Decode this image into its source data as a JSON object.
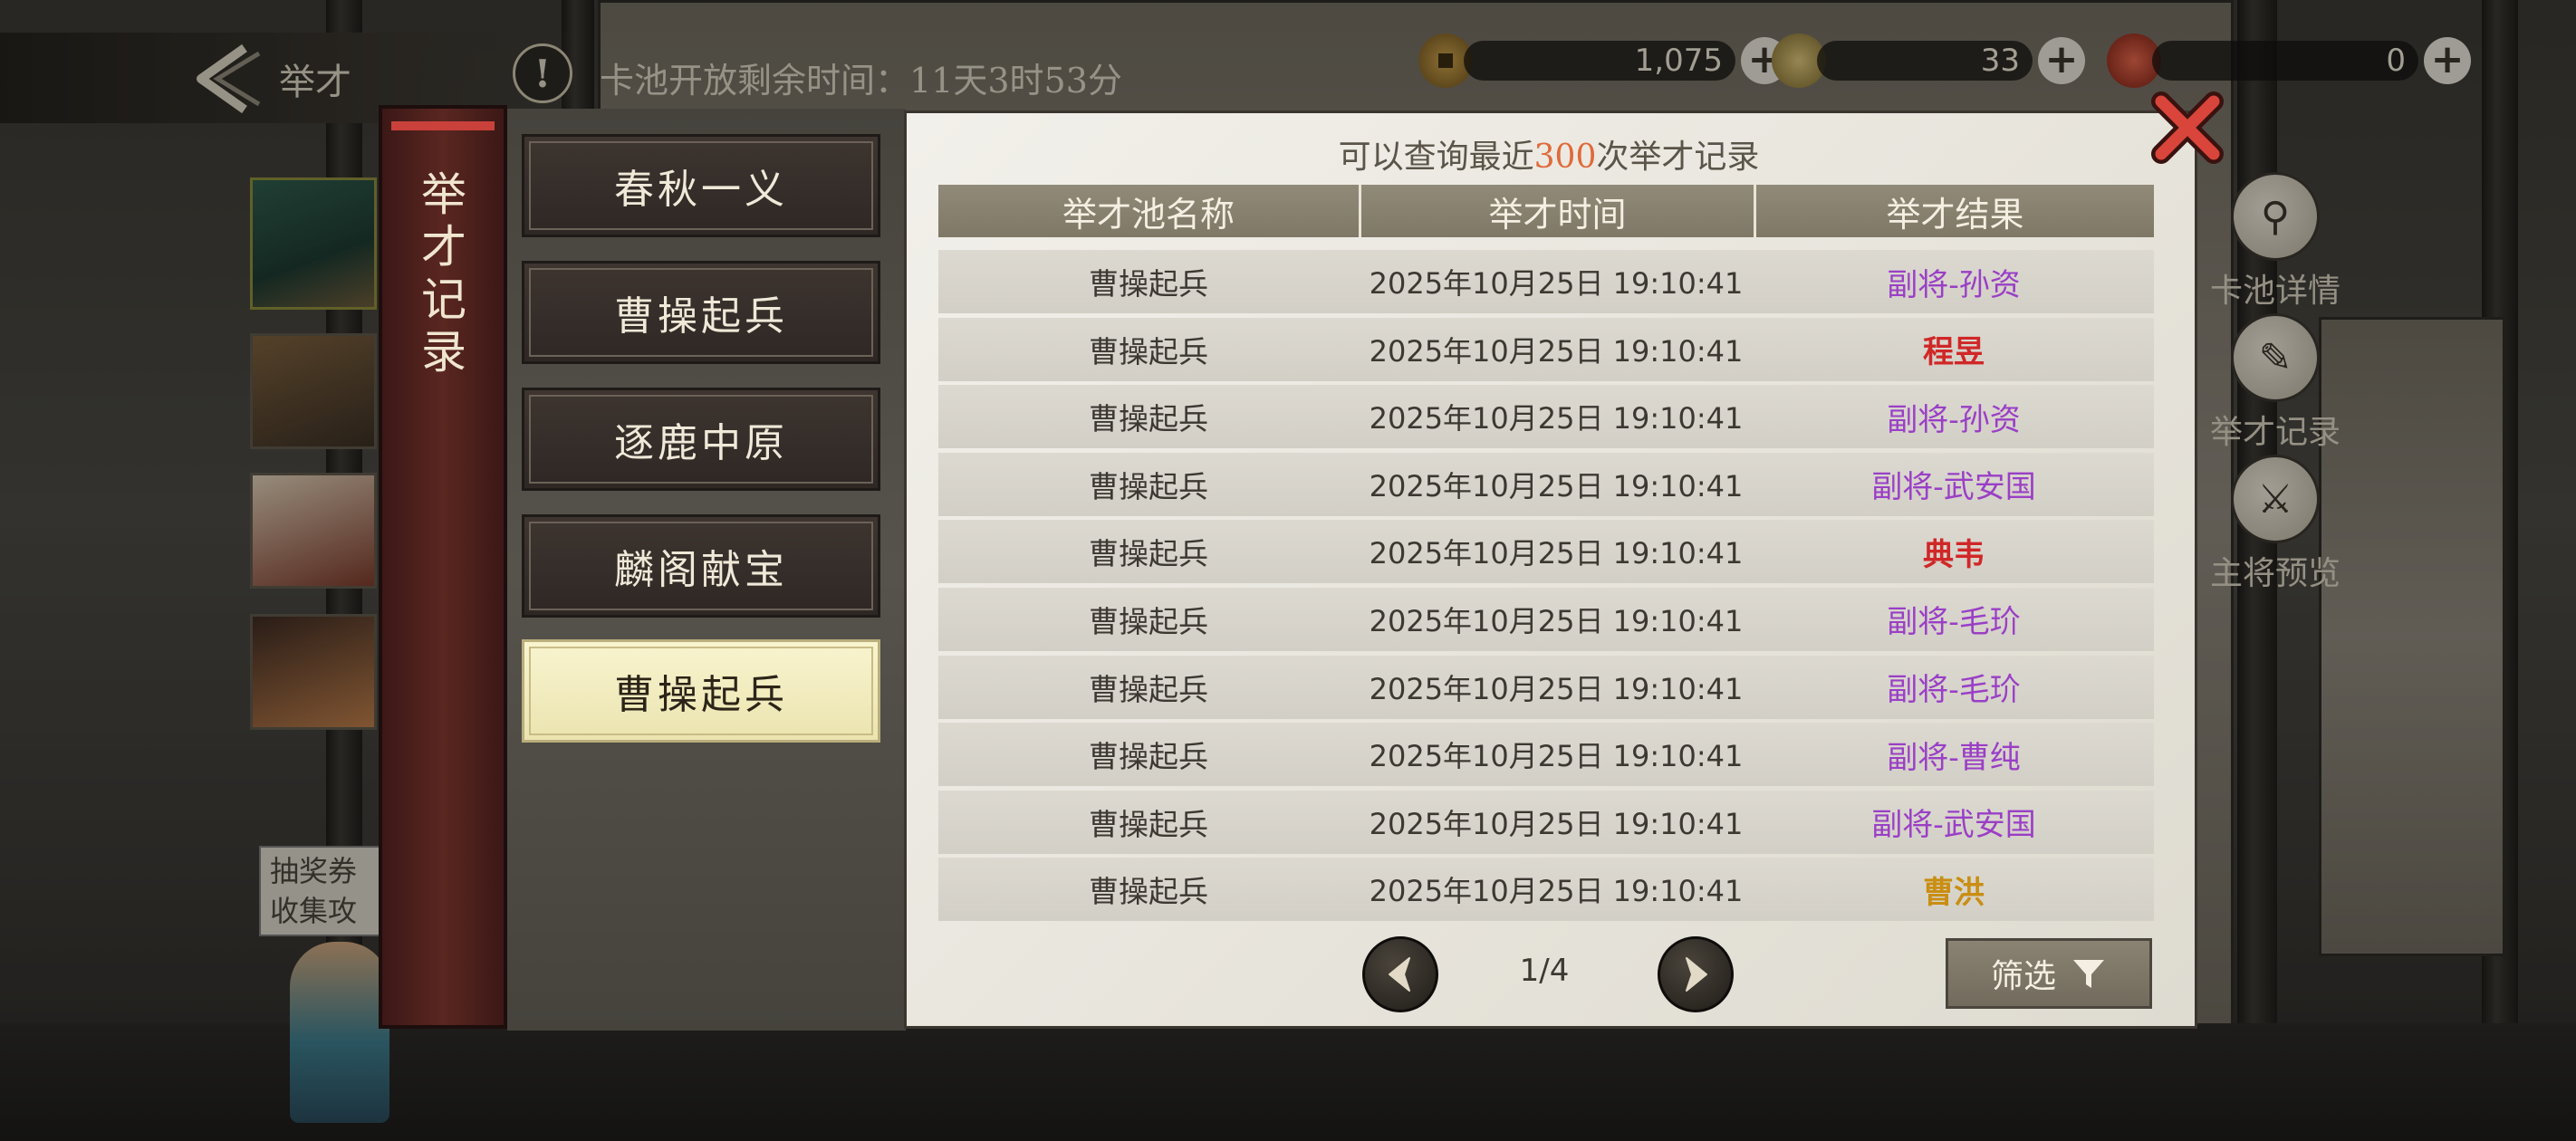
{
  "header": {
    "back_label": "举才",
    "notice_glyph": "!",
    "pool_timer": "卡池开放剩余时间：11天3时53分"
  },
  "currencies": [
    {
      "icon": "copper-coin-icon",
      "value": "1,075"
    },
    {
      "icon": "jade-token-icon",
      "value": "33"
    },
    {
      "icon": "red-seal-icon",
      "value": "0"
    }
  ],
  "side_menu": [
    {
      "label": "卡池详情",
      "icon": "magnifier-icon"
    },
    {
      "label": "举才记录",
      "icon": "scroll-brush-icon"
    },
    {
      "label": "主将预览",
      "icon": "general-preview-icon"
    }
  ],
  "lottery_note": {
    "line1": "抽奖券",
    "line2": "收集攻"
  },
  "modal": {
    "tab_title": "举才记录",
    "pools": [
      {
        "label": "春秋一义",
        "active": false
      },
      {
        "label": "曹操起兵",
        "active": false
      },
      {
        "label": "逐鹿中原",
        "active": false
      },
      {
        "label": "麟阁献宝",
        "active": false
      },
      {
        "label": "曹操起兵",
        "active": true
      }
    ],
    "hint_prefix": "可以查询最近",
    "hint_count": "300",
    "hint_suffix": "次举才记录",
    "columns": [
      "举才池名称",
      "举才时间",
      "举才结果"
    ],
    "rows": [
      {
        "pool": "曹操起兵",
        "time": "2025年10月25日 19:10:41",
        "result": "副将-孙资",
        "quality": "purple"
      },
      {
        "pool": "曹操起兵",
        "time": "2025年10月25日 19:10:41",
        "result": "程昱",
        "quality": "red"
      },
      {
        "pool": "曹操起兵",
        "time": "2025年10月25日 19:10:41",
        "result": "副将-孙资",
        "quality": "purple"
      },
      {
        "pool": "曹操起兵",
        "time": "2025年10月25日 19:10:41",
        "result": "副将-武安国",
        "quality": "purple"
      },
      {
        "pool": "曹操起兵",
        "time": "2025年10月25日 19:10:41",
        "result": "典韦",
        "quality": "red"
      },
      {
        "pool": "曹操起兵",
        "time": "2025年10月25日 19:10:41",
        "result": "副将-毛玠",
        "quality": "purple"
      },
      {
        "pool": "曹操起兵",
        "time": "2025年10月25日 19:10:41",
        "result": "副将-毛玠",
        "quality": "purple"
      },
      {
        "pool": "曹操起兵",
        "time": "2025年10月25日 19:10:41",
        "result": "副将-曹纯",
        "quality": "purple"
      },
      {
        "pool": "曹操起兵",
        "time": "2025年10月25日 19:10:41",
        "result": "副将-武安国",
        "quality": "purple"
      },
      {
        "pool": "曹操起兵",
        "time": "2025年10月25日 19:10:41",
        "result": "曹洪",
        "quality": "gold"
      }
    ],
    "page": "1/4",
    "filter_label": "筛选"
  },
  "colors": {
    "purple": "#9a3fc6",
    "red": "#d02727",
    "gold": "#c98e12",
    "hint_accent": "#e06a3a"
  }
}
